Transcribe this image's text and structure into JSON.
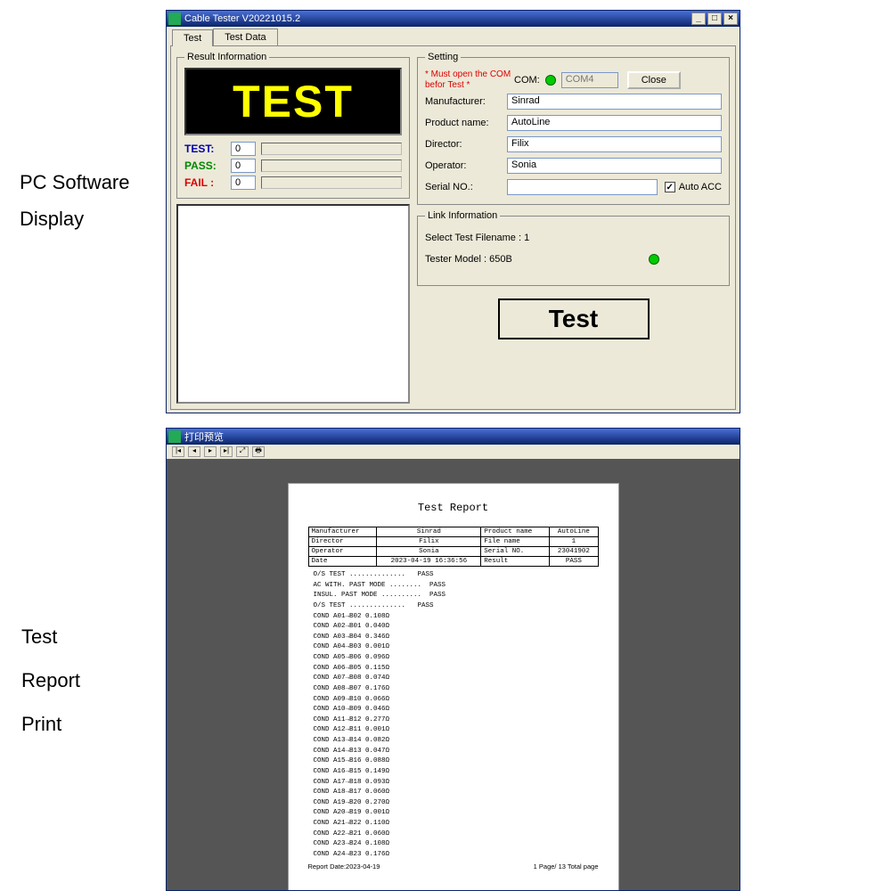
{
  "captions": {
    "c1a": "PC Software",
    "c1b": "Display",
    "c2a": "Test",
    "c2b": "Report",
    "c2c": "Print"
  },
  "app": {
    "title": "Cable Tester V20221015.2",
    "tabs": [
      "Test",
      "Test Data"
    ],
    "result": {
      "legend": "Result Information",
      "display": "TEST",
      "test_lbl": "TEST:",
      "test_val": "0",
      "pass_lbl": "PASS:",
      "pass_val": "0",
      "fail_lbl": "FAIL :",
      "fail_val": "0"
    },
    "setting": {
      "legend": "Setting",
      "warn": "* Must open the COM befor Test *",
      "com_lbl": "COM:",
      "com_val": "COM4",
      "close_btn": "Close",
      "manuf_lbl": "Manufacturer:",
      "manuf_val": "Sinrad",
      "prod_lbl": "Product name:",
      "prod_val": "AutoLine",
      "dir_lbl": "Director:",
      "dir_val": "Filix",
      "op_lbl": "Operator:",
      "op_val": "Sonia",
      "serial_lbl": "Serial NO.:",
      "serial_val": "",
      "autoacc_lbl": "Auto ACC"
    },
    "link": {
      "legend": "Link Information",
      "file_lbl": "Select Test Filename :",
      "file_val": "1",
      "model_lbl": "Tester Model :",
      "model_val": "650B"
    },
    "test_btn": "Test"
  },
  "preview": {
    "title": "打印预览",
    "report_title": "Test Report",
    "header": [
      [
        "Manufacturer",
        "Sinrad",
        "Product name",
        "AutoLine"
      ],
      [
        "Director",
        "Filix",
        "File name",
        "1"
      ],
      [
        "Operator",
        "Sonia",
        "Serial NO.",
        "23041902"
      ],
      [
        "Date",
        "2023-04-19 16:36:56",
        "Result",
        "PASS"
      ]
    ],
    "lines": [
      "O/S TEST ..............   PASS",
      "AC WITH. PAST MODE ........  PASS",
      "INSUL. PAST MODE ..........  PASS",
      "O/S TEST ..............   PASS",
      "COND A01→B02 0.108Ω",
      "COND A02→B01 0.040Ω",
      "COND A03→B04 0.346Ω",
      "COND A04→B03 0.001Ω",
      "COND A05→B06 0.096Ω",
      "COND A06→B05 0.115Ω",
      "COND A07→B08 0.074Ω",
      "COND A08→B07 0.176Ω",
      "COND A09→B10 0.066Ω",
      "COND A10→B09 0.046Ω",
      "COND A11→B12 0.277Ω",
      "COND A12→B11 0.001Ω",
      "COND A13→B14 0.082Ω",
      "COND A14→B13 0.047Ω",
      "COND A15→B16 0.088Ω",
      "COND A16→B15 0.149Ω",
      "COND A17→B18 0.093Ω",
      "COND A18→B17 0.060Ω",
      "COND A19→B20 0.270Ω",
      "COND A20→B19 0.001Ω",
      "COND A21→B22 0.110Ω",
      "COND A22→B21 0.060Ω",
      "COND A23→B24 0.108Ω",
      "COND A24→B23 0.176Ω"
    ],
    "footer_l": "Report Date:2023-04-19",
    "footer_r": "1 Page/ 13 Total page"
  }
}
